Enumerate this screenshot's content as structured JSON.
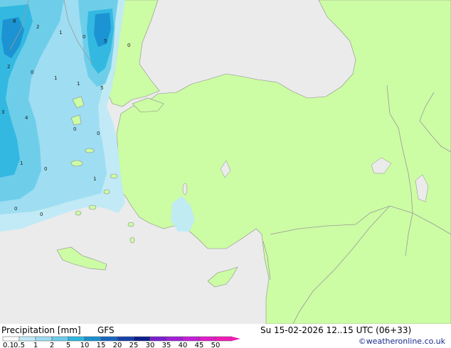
{
  "title": {
    "product": "Precipitation [mm]",
    "model": "GFS",
    "valid": "Su 15-02-2026 12..15 UTC (06+33)"
  },
  "credit": "©weatheronline.co.uk",
  "map": {
    "colors": {
      "sea": "#ebebeb",
      "land": "#ccfca4",
      "border": "#9a9a9a",
      "coast": "#8c8c8c"
    },
    "contour_labels": [
      "8",
      "2",
      "1",
      "0",
      "5",
      "0",
      "2",
      "0",
      "1",
      "1",
      "5",
      "3",
      "4",
      "0",
      "0",
      "1",
      "0",
      "1",
      "0",
      "0"
    ]
  },
  "legend": {
    "ticks": [
      "0.1",
      "0.5",
      "1",
      "2",
      "5",
      "10",
      "15",
      "20",
      "25",
      "30",
      "35",
      "40",
      "45",
      "50"
    ],
    "colors": [
      "#ffffff",
      "#bfeaf7",
      "#9ddcf1",
      "#6ccce9",
      "#2fb7e0",
      "#1a8fd0",
      "#1866c0",
      "#1740a8",
      "#0d1e8a",
      "#7a1fd0",
      "#a21fd6",
      "#c41ed8",
      "#e01dc8",
      "#f01ab6"
    ]
  }
}
